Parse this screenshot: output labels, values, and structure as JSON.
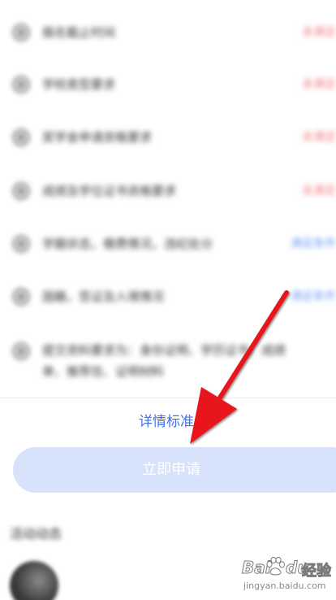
{
  "criteria": {
    "items": [
      {
        "text": "报名截止时间",
        "status": "未满足",
        "status_color": "#f27c7c",
        "multiline": false
      },
      {
        "text": "学校类型要求",
        "status": "未满足",
        "status_color": "#f27c7c",
        "multiline": false
      },
      {
        "text": "奖学金申请资格要求",
        "status": "未满足",
        "status_color": "#f27c7c",
        "multiline": false
      },
      {
        "text": "成绩及学位证书资格要求",
        "status": "未满足",
        "status_color": "#f27c7c",
        "multiline": false
      },
      {
        "text": "学籍状态，缴费情况，违纪处分",
        "status": "满足条件",
        "status_color": "#6a9cf2",
        "multiline": false
      },
      {
        "text": "国籍，签证及入境情况",
        "status": "满足条件",
        "status_color": "#6a9cf2",
        "multiline": false
      },
      {
        "text": "提交资料要求为：身份证明、学历证书、成绩单、推荐信、证明材料",
        "status": "",
        "status_color": "#6a9cf2",
        "multiline": true
      }
    ]
  },
  "details_link": {
    "label": "详情标准"
  },
  "apply_button": {
    "label": "立即申请",
    "background": "#d6e3fb"
  },
  "section": {
    "title": "活动动态"
  },
  "watermark": {
    "logo_left": "Bai",
    "logo_right": "du",
    "logo_suffix": "经验",
    "url": "jingyan.baidu.com"
  },
  "colors": {
    "link": "#3f72e6",
    "arrow": "#e8141c"
  }
}
